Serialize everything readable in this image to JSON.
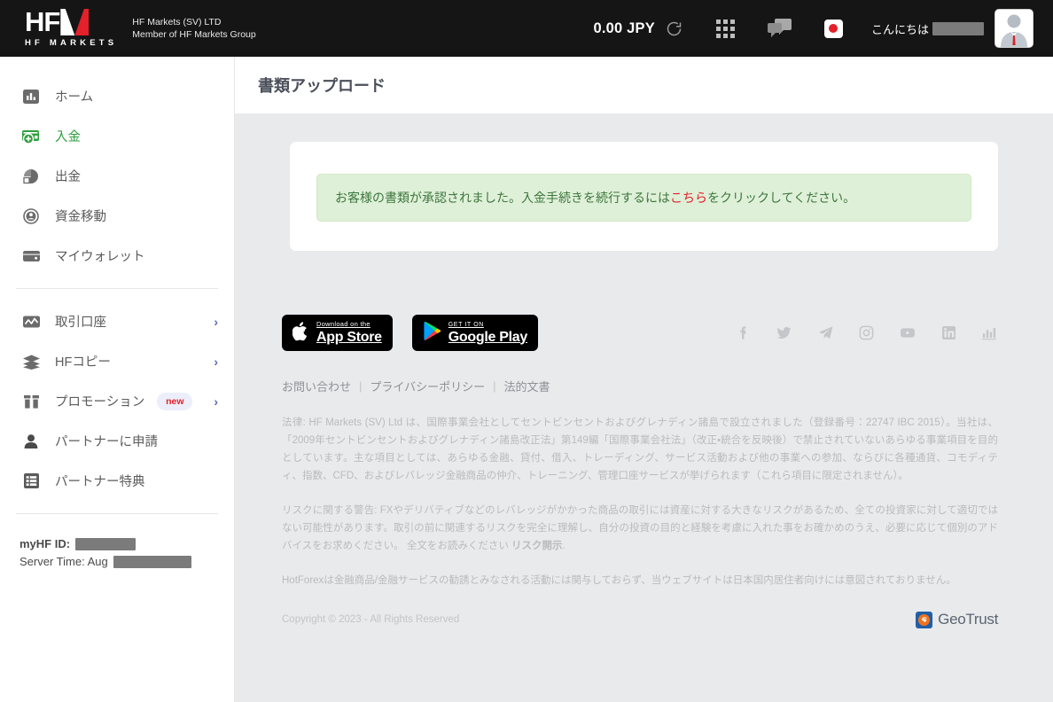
{
  "topbar": {
    "logo": {
      "hf": "HF",
      "m": "M",
      "sub": "HF MARKETS"
    },
    "brand_line1": "HF Markets (SV) LTD",
    "brand_line2": "Member of HF Markets Group",
    "balance": "0.00 JPY",
    "refresh_icon": "refresh-icon",
    "apps_icon": "apps-grid-icon",
    "chat_icon": "chat-bubbles-icon",
    "flag_icon": "japan-flag-icon",
    "greeting": "こんにちは",
    "greeting_name_redacted": "",
    "avatar_icon": "user-avatar"
  },
  "sidebar": {
    "items": [
      {
        "label": "ホーム",
        "icon": "bar-chart-icon",
        "name": "home",
        "active": false,
        "chevron": false,
        "badge": ""
      },
      {
        "label": "入金",
        "icon": "deposit-card-icon",
        "name": "deposit",
        "active": true,
        "chevron": false,
        "badge": ""
      },
      {
        "label": "出金",
        "icon": "withdraw-pie-icon",
        "name": "withdraw",
        "active": false,
        "chevron": false,
        "badge": ""
      },
      {
        "label": "資金移動",
        "icon": "transfer-circle-icon",
        "name": "transfer",
        "active": false,
        "chevron": false,
        "badge": ""
      },
      {
        "label": "マイウォレット",
        "icon": "wallet-icon",
        "name": "my-wallet",
        "active": false,
        "chevron": false,
        "badge": ""
      }
    ],
    "items2": [
      {
        "label": "取引口座",
        "icon": "chart-line-icon",
        "name": "trading-accounts",
        "chevron": true,
        "badge": ""
      },
      {
        "label": "HFコピー",
        "icon": "layers-icon",
        "name": "hf-copy",
        "chevron": true,
        "badge": ""
      },
      {
        "label": "プロモーション",
        "icon": "gift-icon",
        "name": "promotions",
        "chevron": true,
        "badge": "new"
      },
      {
        "label": "パートナーに申請",
        "icon": "person-icon",
        "name": "become-partner",
        "chevron": false,
        "badge": ""
      },
      {
        "label": "パートナー特典",
        "icon": "list-icon",
        "name": "partner-benefits",
        "chevron": false,
        "badge": ""
      }
    ],
    "myhf_id_label": "myHF ID:",
    "myhf_id_value": "",
    "server_time_label": "Server Time: Aug",
    "server_time_value": ""
  },
  "main": {
    "page_title": "書類アップロード",
    "alert": {
      "text_before": "お客様の書類が承認されました。入金手続きを続行するには",
      "link": "こちら",
      "text_after": "をクリックしてください。"
    }
  },
  "footer": {
    "appstore": {
      "small": "Download on the",
      "big": "App Store",
      "icon": "apple-icon"
    },
    "googleplay": {
      "small": "GET IT ON",
      "big": "Google Play",
      "icon": "google-play-icon"
    },
    "socials": [
      {
        "name": "facebook-icon"
      },
      {
        "name": "twitter-icon"
      },
      {
        "name": "telegram-icon"
      },
      {
        "name": "instagram-icon"
      },
      {
        "name": "youtube-icon"
      },
      {
        "name": "linkedin-icon"
      },
      {
        "name": "analytics-chart-icon"
      }
    ],
    "links": [
      {
        "label": "お問い合わせ"
      },
      {
        "label": "プライバシーポリシー"
      },
      {
        "label": "法的文書"
      }
    ],
    "separator": "|",
    "legal_p1": "法律: HF Markets (SV) Ltd は、国際事業会社としてセントビンセントおよびグレナディン諸島で設立されました（登録番号：22747 IBC 2015）。当社は、「2009年セントビンセントおよびグレナディン諸島改正法」第149編「国際事業会社法」（改正・統合を反映後）で禁止されていないあらゆる事業項目を目的としています。主な項目としては、あらゆる金融、貸付、借入、トレーディング、サービス活動および他の事業への参加、ならびに各種通貨、コモディティ、指数、CFD、およびレバレッジ金融商品の仲介、トレーニング、管理口座サービスが挙げられます（これら項目に限定されません）。",
    "legal_p2_before": "リスクに関する警告: FXやデリバティブなどのレバレッジがかかった商品の取引には資産に対する大きなリスクがあるため、全ての投資家に対して適切ではない可能性があります。取引の前に関連するリスクを完全に理解し、自分の投資の目的と経験を考慮に入れた事をお確かめのうえ、必要に応じて個別のアドバイスをお求めください。 全文をお読みください ",
    "legal_p2_bold": "リスク開示",
    "legal_p2_after": ".",
    "legal_p3": "HotForexは金融商品/金融サービスの勧誘とみなされる活動には関与しておらず、当ウェブサイトは日本国内居住者向けには意図されておりません。",
    "copyright": "Copyright © 2023 - All Rights Reserved",
    "geotrust": {
      "text": "GeoTrust",
      "icon": "geotrust-logo"
    }
  },
  "colors": {
    "topbar_bg": "#151515",
    "accent_green": "#2e9e3e",
    "accent_red": "#e4202a",
    "alert_bg": "#dff0d8",
    "alert_text": "#3c763d",
    "content_bg": "#e9eaec"
  }
}
